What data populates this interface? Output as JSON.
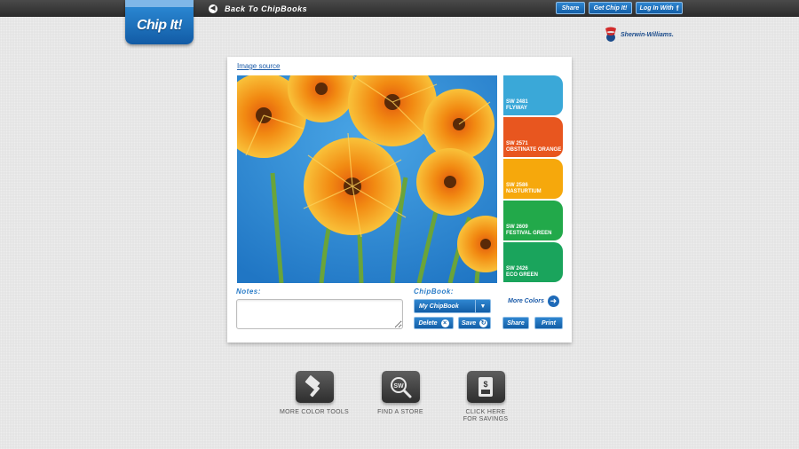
{
  "header": {
    "back_label": "Back To ChipBooks",
    "share_label": "Share",
    "get_chipit_label": "Get Chip It!",
    "login_label": "Log In With",
    "logo_text": "Chip It!",
    "brand_text": "Sherwin-Williams."
  },
  "card": {
    "image_source_label": "Image source",
    "notes_label": "Notes:",
    "notes_value": "",
    "chipbook_label": "ChipBook:",
    "chipbook_selected": "My ChipBook",
    "delete_label": "Delete",
    "save_label": "Save",
    "more_colors_label": "More Colors",
    "share_label": "Share",
    "print_label": "Print"
  },
  "chips": [
    {
      "code": "SW 2481",
      "name": "FLYWAY",
      "color": "#3aa8d8"
    },
    {
      "code": "SW 2571",
      "name": "OBSTINATE ORANGE",
      "color": "#e8561f"
    },
    {
      "code": "SW 2586",
      "name": "NASTURTIUM",
      "color": "#f6a80c"
    },
    {
      "code": "SW 2609",
      "name": "FESTIVAL GREEN",
      "color": "#22a94a"
    },
    {
      "code": "SW 2426",
      "name": "ECO GREEN",
      "color": "#1aa45c"
    }
  ],
  "tools": [
    {
      "label": "MORE COLOR TOOLS",
      "icon": "paint-scraper-icon"
    },
    {
      "label": "FIND A STORE",
      "icon": "sw-search-icon"
    },
    {
      "label": "CLICK HERE FOR SAVINGS",
      "icon": "savings-icon"
    }
  ],
  "colors": {
    "accent": "#1e6ab8",
    "topbar": "#333333",
    "photo_sky": "#2f8fd6",
    "petal": "#f5a61c"
  }
}
